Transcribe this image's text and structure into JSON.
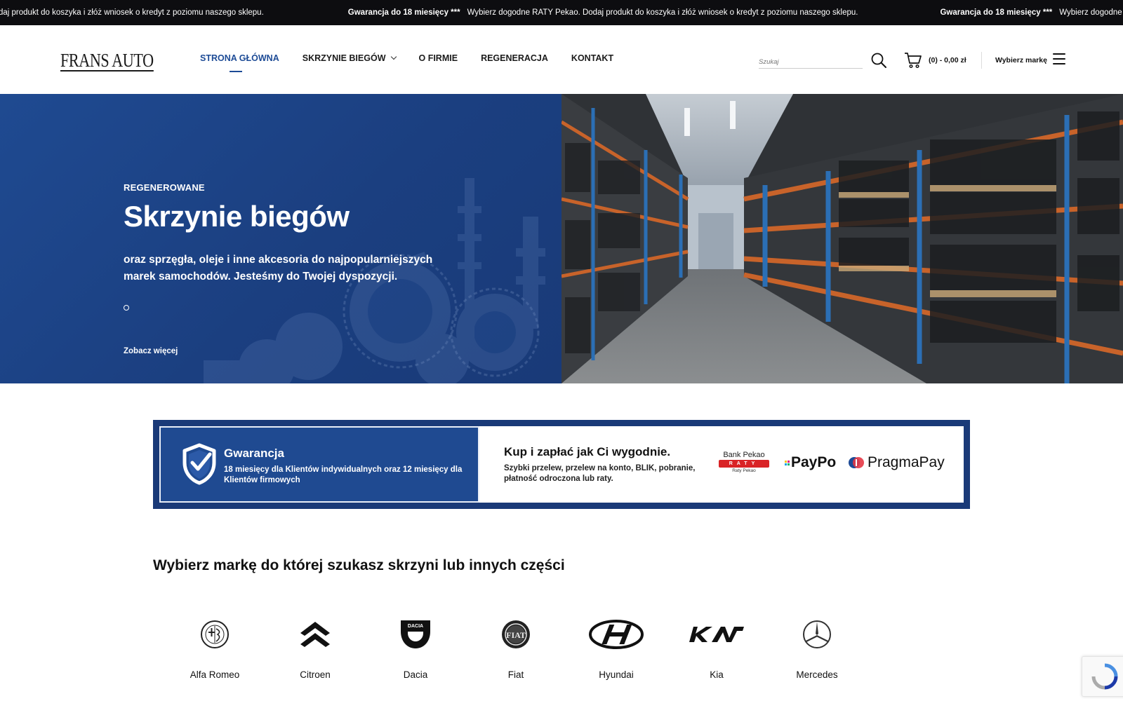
{
  "marquee": {
    "segments": [
      {
        "text": "daj produkt do koszyka i złóż wniosek o kredyt z poziomu naszego sklepu.",
        "bold": false
      },
      {
        "text": "Gwarancja do 18 miesięcy ***",
        "bold": true
      },
      {
        "text": "Wybierz dogodne RATY Pekao. Dodaj produkt do koszyka i złóż wniosek o kredyt z poziomu naszego sklepu.",
        "bold": false
      },
      {
        "text": "Gwarancja do 18 miesięcy ***",
        "bold": true
      },
      {
        "text": "Wybierz dogodne RATY",
        "bold": false
      }
    ]
  },
  "header": {
    "logo_text": "FRANS AUTO",
    "nav": [
      {
        "label": "STRONA GŁÓWNA",
        "active": true,
        "dropdown": false
      },
      {
        "label": "SKRZYNIE BIEGÓW",
        "active": false,
        "dropdown": true
      },
      {
        "label": "O FIRMIE",
        "active": false,
        "dropdown": false
      },
      {
        "label": "REGENERACJA",
        "active": false,
        "dropdown": false
      },
      {
        "label": "KONTAKT",
        "active": false,
        "dropdown": false
      }
    ],
    "search_placeholder": "Szukaj",
    "cart_summary": "(0) - 0,00 zł",
    "brand_picker_label": "Wybierz markę",
    "icons": {
      "search": "search-icon",
      "cart": "cart-icon",
      "menu": "menu-icon"
    }
  },
  "hero": {
    "kicker": "REGENEROWANE",
    "title": "Skrzynie biegów",
    "description": "oraz sprzęgła, oleje i inne akcesoria do najpopularniejszych marek samochodów. Jesteśmy do Twojej dyspozycji.",
    "cta": "Zobacz więcej",
    "slides_total": 1,
    "slide_active": 1,
    "image_alt": "warehouse shelves with gearboxes"
  },
  "info_banner": {
    "guarantee_title": "Gwarancja",
    "guarantee_text": "18 miesięcy dla Klientów indywidualnych oraz 12 miesięcy dla Klientów firmowych",
    "payment_title": "Kup i zapłać jak Ci wygodnie.",
    "payment_text": "Szybki przelew, przelew na konto, BLIK, pobranie, płatność odroczona lub raty.",
    "logos": {
      "pekao_top": "Bank Pekao",
      "pekao_bar": "RATY",
      "pekao_sub": "Raty Pekao",
      "paypo": "PayPo",
      "pragmapay": "PragmaPay"
    }
  },
  "brands_section": {
    "title": "Wybierz markę do której szukasz skrzyni lub innych części",
    "brands": [
      {
        "name": "Alfa Romeo",
        "icon": "alfa-romeo-logo-icon"
      },
      {
        "name": "Citroen",
        "icon": "citroen-logo-icon"
      },
      {
        "name": "Dacia",
        "icon": "dacia-logo-icon"
      },
      {
        "name": "Fiat",
        "icon": "fiat-logo-icon"
      },
      {
        "name": "Hyundai",
        "icon": "hyundai-logo-icon"
      },
      {
        "name": "Kia",
        "icon": "kia-logo-icon"
      },
      {
        "name": "Mercedes",
        "icon": "mercedes-logo-icon"
      }
    ]
  },
  "colors": {
    "primary_blue": "#1f4a91",
    "dark_blue": "#1a3a78",
    "topbar": "#0d0d10",
    "pekao_red": "#d92326",
    "active_nav": "#1d4b96"
  }
}
